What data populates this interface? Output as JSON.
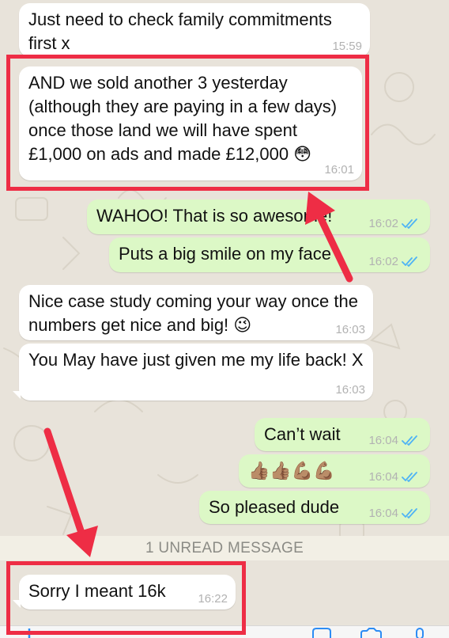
{
  "colors": {
    "background": "#e8e3da",
    "incoming_bubble": "#ffffff",
    "outgoing_bubble": "#dcf8c6",
    "read_ticks": "#4fb3f5",
    "highlight": "#ee2d45"
  },
  "messages": [
    {
      "direction": "in",
      "text": "Just need to check family commitments first x",
      "time": "15:59"
    },
    {
      "direction": "in",
      "text": "AND we sold another 3 yesterday (although they are paying in a few days) once those land we will have spent £1,000 on ads and made £12,000 😳",
      "time": "16:01"
    },
    {
      "direction": "out",
      "text": "WAHOO! That is so awesome!",
      "time": "16:02",
      "status": "read"
    },
    {
      "direction": "out",
      "text": "Puts a big smile on my face",
      "time": "16:02",
      "status": "read"
    },
    {
      "direction": "in",
      "text": "Nice case study coming your way once the numbers get nice and big! 😉",
      "time": "16:03"
    },
    {
      "direction": "in",
      "text": "You May have just given me my life back! X",
      "time": "16:03"
    },
    {
      "direction": "out",
      "text": "Can’t wait",
      "time": "16:04",
      "status": "read"
    },
    {
      "direction": "out",
      "text": "👍🏽👍🏽💪🏽💪🏽",
      "time": "16:04",
      "status": "read"
    },
    {
      "direction": "out",
      "text": "So pleased dude",
      "time": "16:04",
      "status": "read"
    },
    {
      "direction": "in",
      "text": "Sorry I meant 16k",
      "time": "16:22"
    }
  ],
  "unread_banner": "1 UNREAD MESSAGE",
  "composer_icons": [
    "plus-icon",
    "sticker-icon",
    "camera-icon",
    "microphone-icon"
  ]
}
